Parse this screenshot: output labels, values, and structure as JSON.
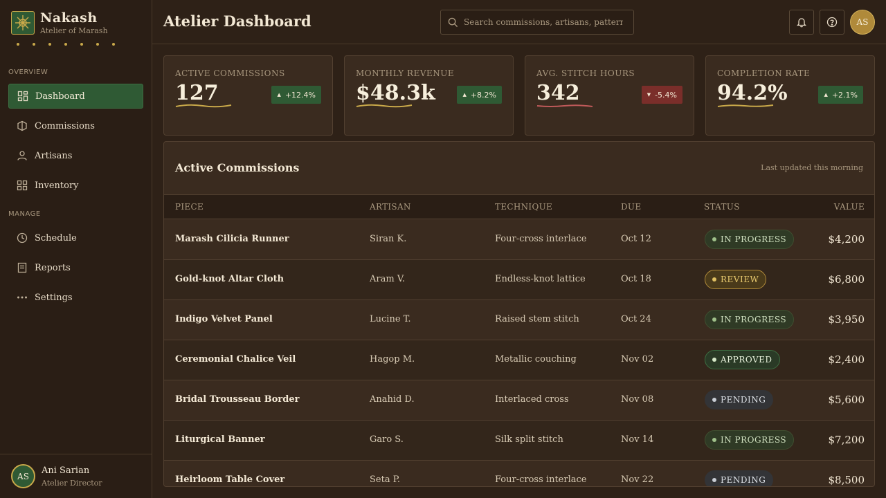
{
  "brand": {
    "name": "Nakash",
    "subtitle": "Atelier of Marash"
  },
  "sidebar": {
    "sections": {
      "overview": "OVERVIEW",
      "manage": "MANAGE"
    },
    "items": [
      {
        "label": "Dashboard",
        "icon": "dashboard-icon",
        "active": true
      },
      {
        "label": "Commissions",
        "icon": "commissions-icon"
      },
      {
        "label": "Artisans",
        "icon": "artisan-icon"
      },
      {
        "label": "Inventory",
        "icon": "inventory-icon"
      },
      {
        "label": "Schedule",
        "icon": "clock-icon"
      },
      {
        "label": "Reports",
        "icon": "report-icon"
      },
      {
        "label": "Settings",
        "icon": "more-icon"
      }
    ]
  },
  "user": {
    "initials": "AS",
    "name": "Ani Sarian",
    "role": "Atelier Director"
  },
  "header": {
    "title": "Atelier Dashboard",
    "search_placeholder": "Search commissions, artisans, patterns...",
    "avatar_initials": "AS"
  },
  "stats": [
    {
      "label": "ACTIVE COMMISSIONS",
      "value": "127",
      "delta": "+12.4%",
      "trend": "up"
    },
    {
      "label": "MONTHLY REVENUE",
      "value": "$48.3k",
      "delta": "+8.2%",
      "trend": "up"
    },
    {
      "label": "AVG. STITCH HOURS",
      "value": "342",
      "delta": "-5.4%",
      "trend": "down"
    },
    {
      "label": "COMPLETION RATE",
      "value": "94.2%",
      "delta": "+2.1%",
      "trend": "up"
    }
  ],
  "table": {
    "title": "Active Commissions",
    "meta": "Last updated this morning",
    "columns": {
      "piece": "PIECE",
      "artisan": "ARTISAN",
      "technique": "TECHNIQUE",
      "due": "DUE",
      "status": "STATUS",
      "value": "VALUE"
    },
    "rows": [
      {
        "piece": "Marash Cilicia Runner",
        "artisan": "Siran K.",
        "technique": "Four-cross interlace",
        "due": "Oct 12",
        "status": "IN PROGRESS",
        "value": "$4,200"
      },
      {
        "piece": "Gold-knot Altar Cloth",
        "artisan": "Aram V.",
        "technique": "Endless-knot lattice",
        "due": "Oct 18",
        "status": "REVIEW",
        "value": "$6,800"
      },
      {
        "piece": "Indigo Velvet Panel",
        "artisan": "Lucine T.",
        "technique": "Raised stem stitch",
        "due": "Oct 24",
        "status": "IN PROGRESS",
        "value": "$3,950"
      },
      {
        "piece": "Ceremonial Chalice Veil",
        "artisan": "Hagop M.",
        "technique": "Metallic couching",
        "due": "Nov 02",
        "status": "APPROVED",
        "value": "$2,400"
      },
      {
        "piece": "Bridal Trousseau Border",
        "artisan": "Anahid D.",
        "technique": "Interlaced cross",
        "due": "Nov 08",
        "status": "PENDING",
        "value": "$5,600"
      },
      {
        "piece": "Liturgical Banner",
        "artisan": "Garo S.",
        "technique": "Silk split stitch",
        "due": "Nov 14",
        "status": "IN PROGRESS",
        "value": "$7,200"
      },
      {
        "piece": "Heirloom Table Cover",
        "artisan": "Seta P.",
        "technique": "Four-cross interlace",
        "due": "Nov 22",
        "status": "PENDING",
        "value": "$8,500"
      }
    ]
  },
  "colors": {
    "accent_green": "#2f5a34",
    "accent_gold": "#c9a94a",
    "negative_red": "#7a2e2a",
    "background": "#2e2117"
  }
}
